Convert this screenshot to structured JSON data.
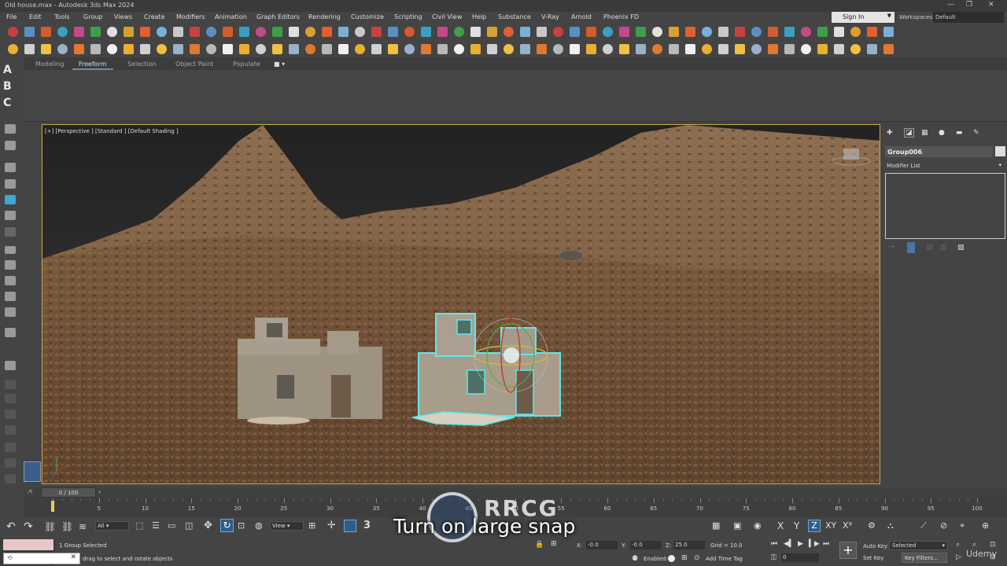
{
  "window": {
    "title": "Old house.max - Autodesk 3ds Max 2024"
  },
  "menu": [
    "File",
    "Edit",
    "Tools",
    "Group",
    "Views",
    "Create",
    "Modifiers",
    "Animation",
    "Graph Editors",
    "Rendering",
    "Customize",
    "Scripting",
    "Civil View",
    "Help",
    "Substance",
    "V-Ray",
    "Arnold",
    "Phoenix FD"
  ],
  "account": {
    "sign_in": "Sign In",
    "workspaces_label": "Workspaces:",
    "workspace": "Default"
  },
  "ribbon": {
    "tabs": [
      "Modeling",
      "Freeform",
      "Selection",
      "Object Paint",
      "Populate"
    ],
    "active": "Freeform"
  },
  "left_toolbar": {
    "letters": [
      "A",
      "B",
      "C"
    ]
  },
  "viewport": {
    "label": "[+] [Perspective ] [Standard ] [Default Shading ]"
  },
  "command_panel": {
    "object_name": "Group006",
    "modifier_list": "Modifier List"
  },
  "timeline": {
    "frame": "0 / 100",
    "ticks": [
      "0",
      "5",
      "10",
      "15",
      "20",
      "25",
      "30",
      "35",
      "40",
      "45",
      "50",
      "55",
      "60",
      "65",
      "70",
      "75",
      "80",
      "85",
      "90",
      "95",
      "100"
    ]
  },
  "status": {
    "selection": "1 Group Selected",
    "prompt": "drag to select and rotate objects",
    "x_label": "X:",
    "x": "-0.0",
    "y_label": "Y:",
    "y": "-0.0",
    "z_label": "Z:",
    "z": "25.0",
    "grid": "Grid = 10.0",
    "enabled": "Enabled:",
    "add_time_tag": "Add Time Tag",
    "auto_key": "Auto Key",
    "set_key": "Set Key",
    "selected": "Selected",
    "key_filters": "Key Filters...",
    "frame_field": "0",
    "view_dropdown": "View",
    "filter_dropdown": "All"
  },
  "overlay": {
    "subtitle": "Turn on large snap",
    "watermark": "RRCG",
    "udemy": "Udemy"
  }
}
